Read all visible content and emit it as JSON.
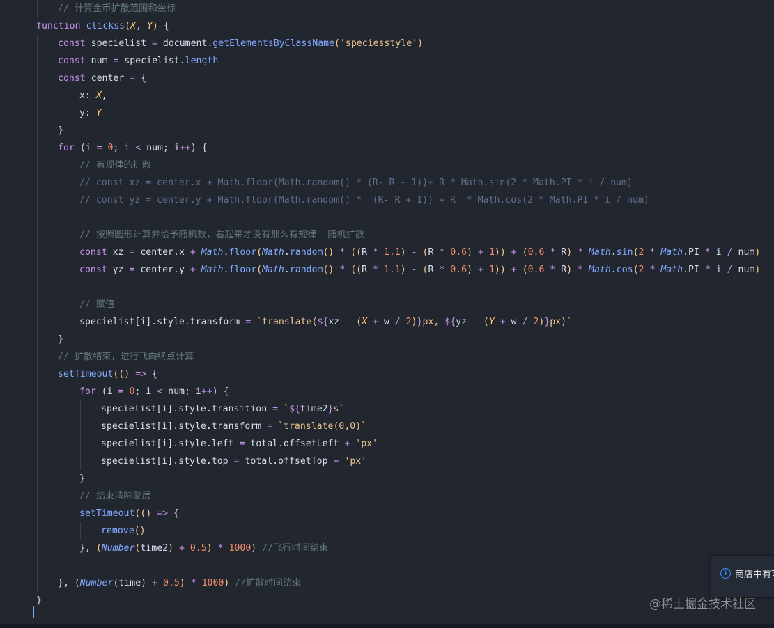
{
  "editor": {
    "lines": [
      [
        [
          "cm",
          "// 计算金币扩散范围和坐标"
        ]
      ],
      [
        [
          "kw",
          "function"
        ],
        [
          "id",
          " "
        ],
        [
          "fn",
          "clickss"
        ],
        [
          "par",
          "("
        ],
        [
          "prm",
          "X"
        ],
        [
          "punc",
          ", "
        ],
        [
          "prm",
          "Y"
        ],
        [
          "par",
          ")"
        ],
        [
          "punc",
          " {"
        ]
      ],
      [
        [
          "kw",
          "const"
        ],
        [
          "id",
          " specielist "
        ],
        [
          "op",
          "="
        ],
        [
          "id",
          " document."
        ],
        [
          "fn",
          "getElementsByClassName"
        ],
        [
          "par",
          "("
        ],
        [
          "str",
          "'speciesstyle'"
        ],
        [
          "par",
          ")"
        ]
      ],
      [
        [
          "kw",
          "const"
        ],
        [
          "id",
          " num "
        ],
        [
          "op",
          "="
        ],
        [
          "id",
          " specielist."
        ],
        [
          "fn",
          "length"
        ]
      ],
      [
        [
          "kw",
          "const"
        ],
        [
          "id",
          " center "
        ],
        [
          "op",
          "="
        ],
        [
          "punc",
          " {"
        ]
      ],
      [
        [
          "key",
          "x"
        ],
        [
          "punc",
          ": "
        ],
        [
          "prm",
          "X"
        ],
        [
          "punc",
          ","
        ]
      ],
      [
        [
          "key",
          "y"
        ],
        [
          "punc",
          ": "
        ],
        [
          "prm",
          "Y"
        ]
      ],
      [
        [
          "punc",
          "}"
        ]
      ],
      [
        [
          "kw",
          "for"
        ],
        [
          "punc",
          " ("
        ],
        [
          "id",
          "i "
        ],
        [
          "op",
          "="
        ],
        [
          "id",
          " "
        ],
        [
          "num",
          "0"
        ],
        [
          "punc",
          "; "
        ],
        [
          "id",
          "i "
        ],
        [
          "op",
          "<"
        ],
        [
          "id",
          " num"
        ],
        [
          "punc",
          "; "
        ],
        [
          "id",
          "i"
        ],
        [
          "op",
          "++"
        ],
        [
          "punc",
          ") {"
        ]
      ],
      [
        [
          "cm",
          "// 有规律的扩散"
        ]
      ],
      [
        [
          "cm2",
          "// const xz = center.x + Math.floor(Math.random() * (R- R + 1))+ R * Math.sin(2 * Math.PI * i / num)"
        ]
      ],
      [
        [
          "cm2",
          "// const yz = center.y + Math.floor(Math.random() *  (R- R + 1)) + R  * Math.cos(2 * Math.PI * i / num)"
        ]
      ],
      [],
      [
        [
          "cm",
          "// 按照圆形计算并给予随机数，看起来才没有那么有规律  随机扩散"
        ]
      ],
      [
        [
          "kw",
          "const"
        ],
        [
          "id",
          " xz "
        ],
        [
          "op",
          "="
        ],
        [
          "id",
          " center.x "
        ],
        [
          "op",
          "+"
        ],
        [
          "id",
          " "
        ],
        [
          "cls",
          "Math"
        ],
        [
          "id",
          "."
        ],
        [
          "mth",
          "floor"
        ],
        [
          "par",
          "("
        ],
        [
          "cls",
          "Math"
        ],
        [
          "id",
          "."
        ],
        [
          "mth",
          "random"
        ],
        [
          "par",
          "()"
        ],
        [
          "id",
          " "
        ],
        [
          "op",
          "*"
        ],
        [
          "id",
          " "
        ],
        [
          "par",
          "(("
        ],
        [
          "id",
          "R "
        ],
        [
          "op",
          "*"
        ],
        [
          "id",
          " "
        ],
        [
          "num",
          "1.1"
        ],
        [
          "par",
          ")"
        ],
        [
          "id",
          " "
        ],
        [
          "op",
          "-"
        ],
        [
          "id",
          " "
        ],
        [
          "par",
          "("
        ],
        [
          "id",
          "R "
        ],
        [
          "op",
          "*"
        ],
        [
          "id",
          " "
        ],
        [
          "num",
          "0.6"
        ],
        [
          "par",
          ")"
        ],
        [
          "id",
          " "
        ],
        [
          "op",
          "+"
        ],
        [
          "id",
          " "
        ],
        [
          "num",
          "1"
        ],
        [
          "par",
          "))"
        ],
        [
          "id",
          " "
        ],
        [
          "op",
          "+"
        ],
        [
          "id",
          " "
        ],
        [
          "par",
          "("
        ],
        [
          "num",
          "0.6"
        ],
        [
          "id",
          " "
        ],
        [
          "op",
          "*"
        ],
        [
          "id",
          " R"
        ],
        [
          "par",
          ")"
        ],
        [
          "id",
          " "
        ],
        [
          "op",
          "*"
        ],
        [
          "id",
          " "
        ],
        [
          "cls",
          "Math"
        ],
        [
          "id",
          "."
        ],
        [
          "mth",
          "sin"
        ],
        [
          "par",
          "("
        ],
        [
          "num",
          "2"
        ],
        [
          "id",
          " "
        ],
        [
          "op",
          "*"
        ],
        [
          "id",
          " "
        ],
        [
          "cls",
          "Math"
        ],
        [
          "id",
          ".PI "
        ],
        [
          "op",
          "*"
        ],
        [
          "id",
          " i "
        ],
        [
          "op",
          "/"
        ],
        [
          "id",
          " num"
        ],
        [
          "par",
          ")"
        ]
      ],
      [
        [
          "kw",
          "const"
        ],
        [
          "id",
          " yz "
        ],
        [
          "op",
          "="
        ],
        [
          "id",
          " center.y "
        ],
        [
          "op",
          "+"
        ],
        [
          "id",
          " "
        ],
        [
          "cls",
          "Math"
        ],
        [
          "id",
          "."
        ],
        [
          "mth",
          "floor"
        ],
        [
          "par",
          "("
        ],
        [
          "cls",
          "Math"
        ],
        [
          "id",
          "."
        ],
        [
          "mth",
          "random"
        ],
        [
          "par",
          "()"
        ],
        [
          "id",
          " "
        ],
        [
          "op",
          "*"
        ],
        [
          "id",
          " "
        ],
        [
          "par",
          "(("
        ],
        [
          "id",
          "R "
        ],
        [
          "op",
          "*"
        ],
        [
          "id",
          " "
        ],
        [
          "num",
          "1.1"
        ],
        [
          "par",
          ")"
        ],
        [
          "id",
          " "
        ],
        [
          "op",
          "-"
        ],
        [
          "id",
          " "
        ],
        [
          "par",
          "("
        ],
        [
          "id",
          "R "
        ],
        [
          "op",
          "*"
        ],
        [
          "id",
          " "
        ],
        [
          "num",
          "0.6"
        ],
        [
          "par",
          ")"
        ],
        [
          "id",
          " "
        ],
        [
          "op",
          "+"
        ],
        [
          "id",
          " "
        ],
        [
          "num",
          "1"
        ],
        [
          "par",
          "))"
        ],
        [
          "id",
          " "
        ],
        [
          "op",
          "+"
        ],
        [
          "id",
          " "
        ],
        [
          "par",
          "("
        ],
        [
          "num",
          "0.6"
        ],
        [
          "id",
          " "
        ],
        [
          "op",
          "*"
        ],
        [
          "id",
          " R"
        ],
        [
          "par",
          ")"
        ],
        [
          "id",
          " "
        ],
        [
          "op",
          "*"
        ],
        [
          "id",
          " "
        ],
        [
          "cls",
          "Math"
        ],
        [
          "id",
          "."
        ],
        [
          "mth",
          "cos"
        ],
        [
          "par",
          "("
        ],
        [
          "num",
          "2"
        ],
        [
          "id",
          " "
        ],
        [
          "op",
          "*"
        ],
        [
          "id",
          " "
        ],
        [
          "cls",
          "Math"
        ],
        [
          "id",
          ".PI "
        ],
        [
          "op",
          "*"
        ],
        [
          "id",
          " i "
        ],
        [
          "op",
          "/"
        ],
        [
          "id",
          " num"
        ],
        [
          "par",
          ")"
        ]
      ],
      [],
      [
        [
          "cm",
          "// 赋值"
        ]
      ],
      [
        [
          "id",
          "specielist[i].style.transform "
        ],
        [
          "op",
          "="
        ],
        [
          "id",
          " "
        ],
        [
          "tpl",
          "`translate("
        ],
        [
          "op",
          "${"
        ],
        [
          "id",
          "xz "
        ],
        [
          "op",
          "-"
        ],
        [
          "id",
          " "
        ],
        [
          "par",
          "("
        ],
        [
          "prm",
          "X"
        ],
        [
          "id",
          " "
        ],
        [
          "op",
          "+"
        ],
        [
          "id",
          " w "
        ],
        [
          "op",
          "/"
        ],
        [
          "id",
          " "
        ],
        [
          "num",
          "2"
        ],
        [
          "par",
          ")"
        ],
        [
          "op",
          "}"
        ],
        [
          "tpl",
          "px, "
        ],
        [
          "op",
          "${"
        ],
        [
          "id",
          "yz "
        ],
        [
          "op",
          "-"
        ],
        [
          "id",
          " "
        ],
        [
          "par",
          "("
        ],
        [
          "prm",
          "Y"
        ],
        [
          "id",
          " "
        ],
        [
          "op",
          "+"
        ],
        [
          "id",
          " w "
        ],
        [
          "op",
          "/"
        ],
        [
          "id",
          " "
        ],
        [
          "num",
          "2"
        ],
        [
          "par",
          ")"
        ],
        [
          "op",
          "}"
        ],
        [
          "tpl",
          "px)`"
        ]
      ],
      [
        [
          "punc",
          "}"
        ]
      ],
      [
        [
          "cm",
          "// 扩散结束，进行飞向终点计算"
        ]
      ],
      [
        [
          "fn",
          "setTimeout"
        ],
        [
          "par",
          "(()"
        ],
        [
          "id",
          " "
        ],
        [
          "kw",
          "=>"
        ],
        [
          "punc",
          " {"
        ]
      ],
      [
        [
          "kw",
          "for"
        ],
        [
          "punc",
          " ("
        ],
        [
          "id",
          "i "
        ],
        [
          "op",
          "="
        ],
        [
          "id",
          " "
        ],
        [
          "num",
          "0"
        ],
        [
          "punc",
          "; "
        ],
        [
          "id",
          "i "
        ],
        [
          "op",
          "<"
        ],
        [
          "id",
          " num"
        ],
        [
          "punc",
          "; "
        ],
        [
          "id",
          "i"
        ],
        [
          "op",
          "++"
        ],
        [
          "punc",
          ") {"
        ]
      ],
      [
        [
          "id",
          "specielist[i].style.transition "
        ],
        [
          "op",
          "="
        ],
        [
          "id",
          " "
        ],
        [
          "tpl",
          "`"
        ],
        [
          "op",
          "${"
        ],
        [
          "id",
          "time2"
        ],
        [
          "op",
          "}"
        ],
        [
          "tpl",
          "s`"
        ]
      ],
      [
        [
          "id",
          "specielist[i].style.transform "
        ],
        [
          "op",
          "="
        ],
        [
          "id",
          " "
        ],
        [
          "tpl",
          "`translate(0,0)`"
        ]
      ],
      [
        [
          "id",
          "specielist[i].style.left "
        ],
        [
          "op",
          "="
        ],
        [
          "id",
          " total.offsetLeft "
        ],
        [
          "op",
          "+"
        ],
        [
          "id",
          " "
        ],
        [
          "str",
          "'px'"
        ]
      ],
      [
        [
          "id",
          "specielist[i].style.top "
        ],
        [
          "op",
          "="
        ],
        [
          "id",
          " total.offsetTop "
        ],
        [
          "op",
          "+"
        ],
        [
          "id",
          " "
        ],
        [
          "str",
          "'px'"
        ]
      ],
      [
        [
          "punc",
          "}"
        ]
      ],
      [
        [
          "cm",
          "// 结束清除蒙层"
        ]
      ],
      [
        [
          "fn",
          "setTimeout"
        ],
        [
          "par",
          "(()"
        ],
        [
          "id",
          " "
        ],
        [
          "kw",
          "=>"
        ],
        [
          "punc",
          " {"
        ]
      ],
      [
        [
          "fn",
          "remove"
        ],
        [
          "par",
          "()"
        ]
      ],
      [
        [
          "punc",
          "}, "
        ],
        [
          "par",
          "("
        ],
        [
          "cls",
          "Number"
        ],
        [
          "par",
          "("
        ],
        [
          "id",
          "time2"
        ],
        [
          "par",
          ")"
        ],
        [
          "id",
          " "
        ],
        [
          "op",
          "+"
        ],
        [
          "id",
          " "
        ],
        [
          "num",
          "0.5"
        ],
        [
          "par",
          ")"
        ],
        [
          "id",
          " "
        ],
        [
          "op",
          "*"
        ],
        [
          "id",
          " "
        ],
        [
          "num",
          "1000"
        ],
        [
          "par",
          ")"
        ],
        [
          "id",
          " "
        ],
        [
          "cm",
          "//飞行时间结束"
        ]
      ],
      [],
      [
        [
          "punc",
          "}, "
        ],
        [
          "par",
          "("
        ],
        [
          "cls",
          "Number"
        ],
        [
          "par",
          "("
        ],
        [
          "id",
          "time"
        ],
        [
          "par",
          ")"
        ],
        [
          "id",
          " "
        ],
        [
          "op",
          "+"
        ],
        [
          "id",
          " "
        ],
        [
          "num",
          "0.5"
        ],
        [
          "par",
          ")"
        ],
        [
          "id",
          " "
        ],
        [
          "op",
          "*"
        ],
        [
          "id",
          " "
        ],
        [
          "num",
          "1000"
        ],
        [
          "par",
          ")"
        ],
        [
          "id",
          " "
        ],
        [
          "cm",
          "//扩散时间结束"
        ]
      ],
      [
        [
          "punc",
          "}"
        ]
      ]
    ],
    "indents": [
      1,
      0,
      1,
      1,
      1,
      2,
      2,
      1,
      1,
      2,
      2,
      2,
      0,
      2,
      2,
      2,
      0,
      2,
      2,
      1,
      1,
      1,
      2,
      3,
      3,
      3,
      3,
      2,
      2,
      2,
      3,
      2,
      0,
      1,
      0
    ]
  },
  "notification": {
    "icon": "info-icon",
    "text": "商店中有可"
  },
  "watermark": {
    "text": "@稀土掘金技术社区"
  },
  "theme": {
    "background": "#22262f",
    "accent": "#3794ff"
  }
}
